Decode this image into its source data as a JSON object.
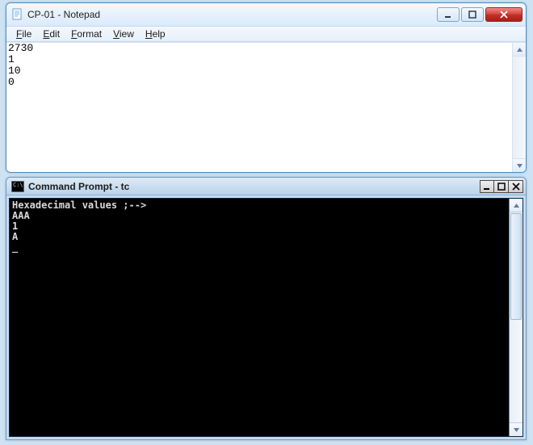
{
  "notepad": {
    "title": "CP-01 - Notepad",
    "menu": {
      "file": "File",
      "edit": "Edit",
      "format": "Format",
      "view": "View",
      "help": "Help"
    },
    "content": "2730\n1\n10\n0"
  },
  "cmd": {
    "title": "Command Prompt - tc",
    "content": "Hexadecimal values ;-->\nAAA\n1\nA\n_"
  }
}
